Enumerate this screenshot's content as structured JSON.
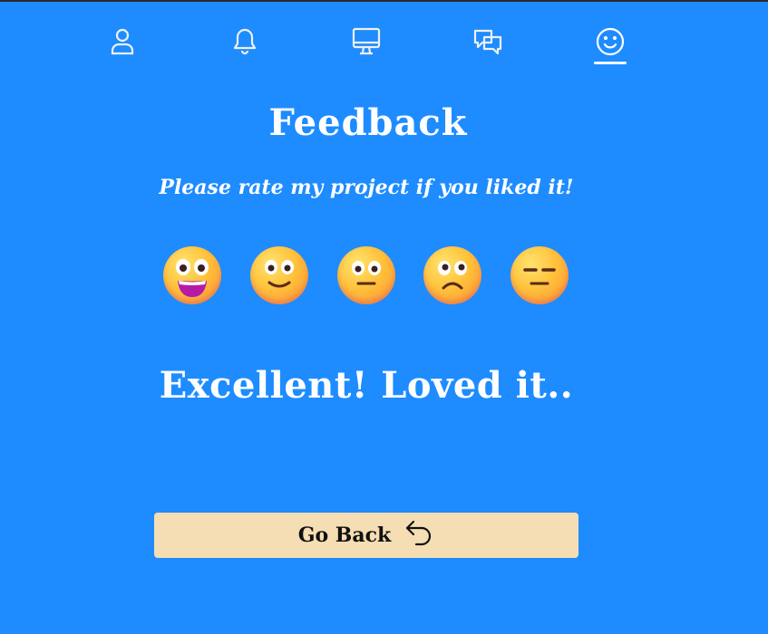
{
  "nav": {
    "items": [
      {
        "icon": "user-icon",
        "active": false
      },
      {
        "icon": "bell-icon",
        "active": false
      },
      {
        "icon": "monitor-icon",
        "active": false
      },
      {
        "icon": "chat-icon",
        "active": false
      },
      {
        "icon": "smile-icon",
        "active": true
      }
    ]
  },
  "feedback": {
    "title": "Feedback",
    "subtitle": "Please rate my project if you liked it!",
    "options": [
      {
        "icon": "grinning-face-emoji"
      },
      {
        "icon": "smiling-face-emoji"
      },
      {
        "icon": "neutral-face-emoji"
      },
      {
        "icon": "frowning-face-emoji"
      },
      {
        "icon": "expressionless-face-emoji"
      }
    ],
    "result": "Excellent! Loved it.."
  },
  "back_button": {
    "label": "Go Back",
    "icon": "back-arrow-icon"
  },
  "colors": {
    "background": "#1e8cff",
    "button": "#f5deb3",
    "text": "#ffffff"
  }
}
